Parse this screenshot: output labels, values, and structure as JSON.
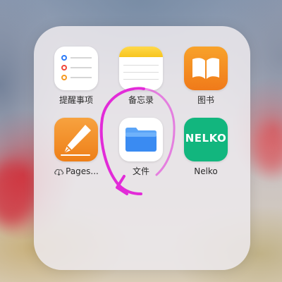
{
  "folder": {
    "apps": [
      {
        "label": "提醒事项",
        "icon": "reminders-icon"
      },
      {
        "label": "备忘录",
        "icon": "notes-icon"
      },
      {
        "label": "图书",
        "icon": "books-icon"
      },
      {
        "label": "Pages...",
        "icon": "pages-icon",
        "cloud_download": true
      },
      {
        "label": "文件",
        "icon": "files-folder-icon"
      },
      {
        "label": "Nelko",
        "icon": "nelko-icon",
        "icon_text": "NELKO"
      }
    ]
  },
  "colors": {
    "annotation_stroke": "#e22bd8",
    "reminder_dots": [
      "#2f7cf6",
      "#f0473a",
      "#f59a23"
    ],
    "nelko_green": "#12b67e",
    "files_blue": "#3a8bf2"
  }
}
